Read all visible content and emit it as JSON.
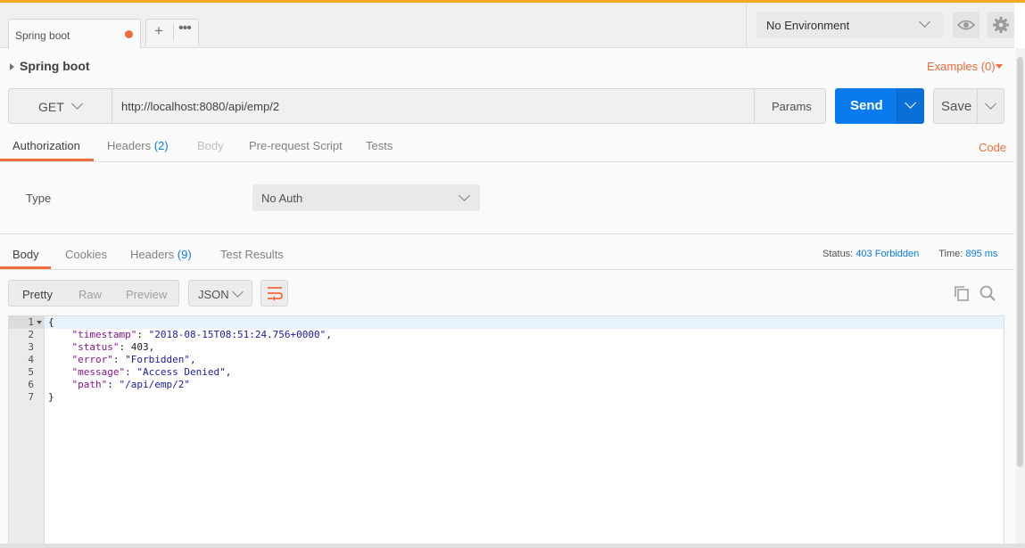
{
  "tabs": {
    "active_tab_label": "Spring boot",
    "new_tab_symbol": "+",
    "more_symbol": "•••"
  },
  "environment": {
    "selected": "No Environment"
  },
  "collection": {
    "title": "Spring boot",
    "examples_label": "Examples (0)"
  },
  "request": {
    "method": "GET",
    "url": "http://localhost:8080/api/emp/2",
    "params_label": "Params",
    "send_label": "Send",
    "save_label": "Save"
  },
  "request_tabs": {
    "authorization": "Authorization",
    "headers": "Headers",
    "headers_count": "(2)",
    "body": "Body",
    "prerequest": "Pre-request Script",
    "tests": "Tests",
    "code": "Code"
  },
  "auth": {
    "type_label": "Type",
    "type_value": "No Auth"
  },
  "response_tabs": {
    "body": "Body",
    "cookies": "Cookies",
    "headers": "Headers",
    "headers_count": "(9)",
    "test_results": "Test Results"
  },
  "response_meta": {
    "status_label": "Status:",
    "status_value": "403 Forbidden",
    "time_label": "Time:",
    "time_value": "895 ms"
  },
  "view_modes": {
    "pretty": "Pretty",
    "raw": "Raw",
    "preview": "Preview",
    "format": "JSON"
  },
  "response_body": {
    "line_numbers": [
      "1",
      "2",
      "3",
      "4",
      "5",
      "6",
      "7"
    ],
    "open_brace": "{",
    "close_brace": "}",
    "fields": [
      {
        "key": "\"timestamp\"",
        "value": "\"2018-08-15T08:51:24.756+0000\"",
        "value_type": "string",
        "trail": ","
      },
      {
        "key": "\"status\"",
        "value": "403",
        "value_type": "number",
        "trail": ","
      },
      {
        "key": "\"error\"",
        "value": "\"Forbidden\"",
        "value_type": "string",
        "trail": ","
      },
      {
        "key": "\"message\"",
        "value": "\"Access Denied\"",
        "value_type": "string",
        "trail": ","
      },
      {
        "key": "\"path\"",
        "value": "\"/api/emp/2\"",
        "value_type": "string",
        "trail": ""
      }
    ]
  },
  "colors": {
    "accent_orange": "#f26b3a",
    "send_blue": "#097bed",
    "top_bar": "#f5a623"
  }
}
